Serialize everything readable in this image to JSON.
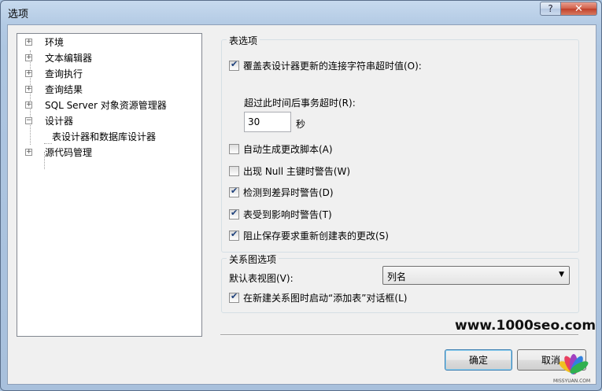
{
  "window": {
    "title": "选项",
    "help_glyph": "?",
    "close_glyph": "✕"
  },
  "tree": {
    "items": [
      {
        "label": "环境",
        "expander": "+"
      },
      {
        "label": "文本编辑器",
        "expander": "+"
      },
      {
        "label": "查询执行",
        "expander": "+"
      },
      {
        "label": "查询结果",
        "expander": "+"
      },
      {
        "label": "SQL Server 对象资源管理器",
        "expander": "+"
      },
      {
        "label": "设计器",
        "expander": "−"
      },
      {
        "label": "表设计器和数据库设计器",
        "expander": ""
      },
      {
        "label": "源代码管理",
        "expander": "+"
      }
    ]
  },
  "table_options": {
    "title": "表选项",
    "override_timeout": {
      "label": "覆盖表设计器更新的连接字符串超时值(O):",
      "checked": true
    },
    "timeout_label": "超过此时间后事务超时(R):",
    "timeout_value": "30",
    "timeout_unit": "秒",
    "auto_script": {
      "label": "自动生成更改脚本(A)",
      "checked": false
    },
    "null_pk_warning": {
      "label": "出现 Null 主键时警告(W)",
      "checked": false
    },
    "diff_warning": {
      "label": "检测到差异时警告(D)",
      "checked": true
    },
    "affected_warning": {
      "label": "表受到影响时警告(T)",
      "checked": true
    },
    "prevent_recreate": {
      "label": "阻止保存要求重新创建表的更改(S)",
      "checked": true
    }
  },
  "diagram_options": {
    "title": "关系图选项",
    "default_view_label": "默认表视图(V):",
    "default_view_value": "列名",
    "launch_add_table": {
      "label": "在新建关系图时启动“添加表”对话框(L)",
      "checked": true
    }
  },
  "watermark": "www.1000seo.com",
  "buttons": {
    "ok": "确定",
    "cancel": "取消"
  },
  "logo_text": "MISSYUAN.COM",
  "colors": {
    "title_bar": "#b8cfe8",
    "close_button": "#c8503a",
    "check_mark": "#1c3f7a"
  }
}
